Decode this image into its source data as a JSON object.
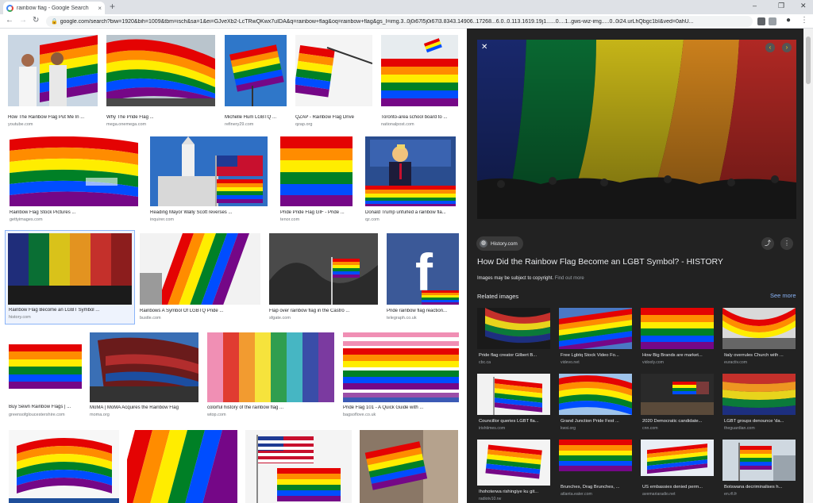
{
  "browser": {
    "tab_title": "rainbow flag - Google Search",
    "tab_close": "×",
    "new_tab": "+",
    "url": "google.com/search?biw=1920&bih=1009&tbm=isch&sa=1&ei=GJveXb2-LcTRwQKwx7uIDA&q=rainbow+flag&oq=rainbow+flag&gs_l=img.3..0j0i67l5j0i67l3.8343.14906..17268...6.0..0.113.1619.19j1......0....1..gws-wiz-img.....0..0i24.urLhQbgc1bI&ved=0ahU...",
    "min_glyph": "–",
    "max_glyph": "❐",
    "close_glyph": "✕",
    "back_glyph": "←",
    "forward_glyph": "→",
    "reload_glyph": "↻",
    "lock_glyph": "🔒",
    "profile_glyph": "●",
    "menu_glyph": "⋮"
  },
  "results": [
    {
      "caption": "How The Rainbow Flag Put Me In ...",
      "source": "youtube.com"
    },
    {
      "caption": "Why The Pride Flag ...",
      "source": "mega.onemega.com"
    },
    {
      "caption": "Michelle Hum LGBTQ ...",
      "source": "refinery29.com"
    },
    {
      "caption": "QZAP - Rainbow Flag Drive",
      "source": "qzap.org"
    },
    {
      "caption": "Toronto-area school board to ...",
      "source": "nationalpost.com"
    },
    {
      "caption": "Rainbow Flag Stock Pictures ...",
      "source": "gettyimages.com"
    },
    {
      "caption": "Reading Mayor Wally Scott reverses ...",
      "source": "inquirer.com"
    },
    {
      "caption": "Pride Pride Flag GIF - Pride ...",
      "source": "tenor.com"
    },
    {
      "caption": "Donald Trump unfurled a rainbow fla...",
      "source": "qz.com"
    },
    {
      "caption": "Rainbow Flag Become an LGBT Symbol ...",
      "source": "history.com"
    },
    {
      "caption": "Rainbows A Symbol Of LGBTQ Pride ...",
      "source": "bustle.com"
    },
    {
      "caption": "Flap over rainbow flag in the Castro ...",
      "source": "sfgate.com"
    },
    {
      "caption": "Pride rainbow flag reaction...",
      "source": "telegraph.co.uk"
    },
    {
      "caption": "Buy Sewn Rainbow Flags | ...",
      "source": "greensofgloucestershire.com"
    },
    {
      "caption": "MoMA | MoMA Acquires the Rainbow Flag",
      "source": "moma.org"
    },
    {
      "caption": "colorful history of the rainbow flag ...",
      "source": "wtop.com"
    },
    {
      "caption": "Pride Flag 101 - A Quick Guide with ...",
      "source": "bagsoflove.co.uk"
    }
  ],
  "panel": {
    "close_glyph": "✕",
    "prev_glyph": "‹",
    "next_glyph": "›",
    "source_site": "History.com",
    "globe_glyph": "◍",
    "share_glyph": "⤴",
    "more_glyph": "⋮",
    "title": "How Did the Rainbow Flag Become an LGBT Symbol? - HISTORY",
    "copyright": "Images may be subject to copyright.",
    "find_out_more": "Find out more",
    "related_label": "Related images",
    "see_more": "See more",
    "related": [
      {
        "caption": "Pride flag creator Gilbert B...",
        "source": "cbc.ca"
      },
      {
        "caption": "Free Lgbtq Stock Video Fo...",
        "source": "videvo.net"
      },
      {
        "caption": "How Big Brands are market...",
        "source": "vidooly.com"
      },
      {
        "caption": "Italy overrules Church with ...",
        "source": "euractiv.com"
      },
      {
        "caption": "Councillor queries LGBT fla...",
        "source": "irishtimes.com"
      },
      {
        "caption": "Grand Junction Pride Fest ...",
        "source": "kwsi.org"
      },
      {
        "caption": "2020 Democratic candidate...",
        "source": "cnn.com"
      },
      {
        "caption": "LGBT groups denounce 'da...",
        "source": "theguardian.com"
      },
      {
        "caption": "Ihohoterwa rishingiye ku git...",
        "source": "radiotv10.rw"
      },
      {
        "caption": "Brunches, Drag Brunches, ...",
        "source": "atlanta.eater.com"
      },
      {
        "caption": "US embassies denied perm...",
        "source": "avemariaradio.net"
      },
      {
        "caption": "Botswana decriminalises h...",
        "source": "en.rfi.fr"
      }
    ]
  },
  "colors": {
    "red": "#e40303",
    "orange": "#ff8c00",
    "yellow": "#ffed00",
    "green": "#008026",
    "blue": "#004dff",
    "violet": "#750787",
    "panel_bg": "#222222",
    "link_blue": "#8ab4f8"
  }
}
